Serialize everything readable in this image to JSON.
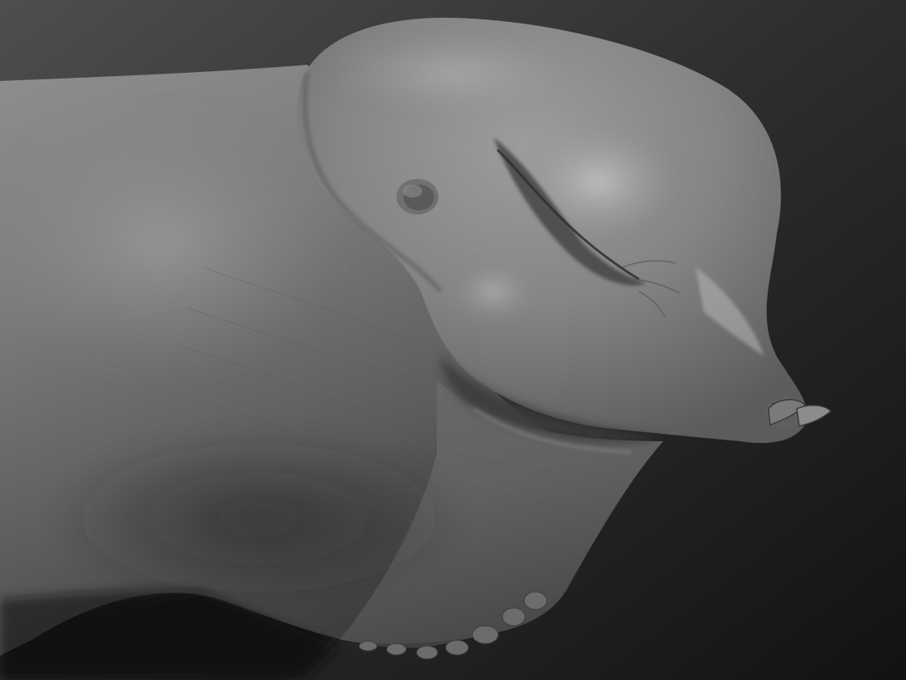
{
  "scene": {
    "subject": "sculpt-render",
    "background_colors": [
      "#505050",
      "#2e2e2e",
      "#121212"
    ],
    "material_colors": {
      "highlight": "#b4b4b4",
      "base": "#8a8a8a",
      "midtone": "#6e6e6e",
      "shadow": "#3a3a3a",
      "deep_shadow": "#242424"
    }
  }
}
